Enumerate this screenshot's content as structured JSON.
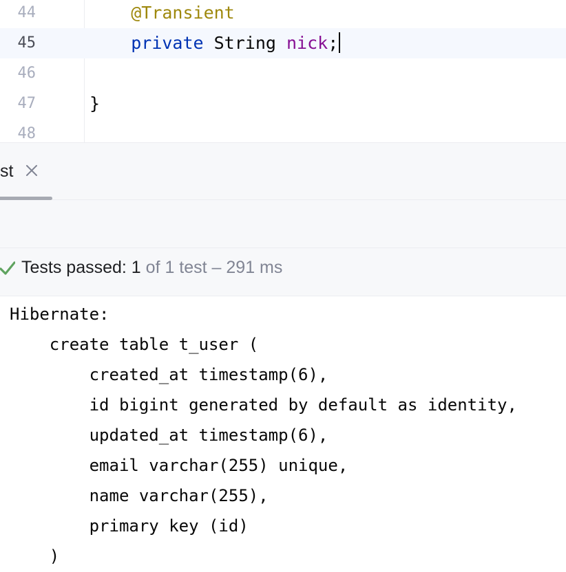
{
  "editor": {
    "lines": [
      {
        "number": "44",
        "segments": [
          {
            "text": "    ",
            "cls": ""
          },
          {
            "text": "@Transient",
            "cls": "ann"
          }
        ]
      },
      {
        "number": "45",
        "current": true,
        "segments": [
          {
            "text": "    ",
            "cls": ""
          },
          {
            "text": "private",
            "cls": "kw"
          },
          {
            "text": " String ",
            "cls": ""
          },
          {
            "text": "nick",
            "cls": "field"
          },
          {
            "text": ";",
            "cls": ""
          }
        ]
      },
      {
        "number": "46",
        "segments": []
      },
      {
        "number": "47",
        "segments": [
          {
            "text": "}",
            "cls": ""
          }
        ]
      },
      {
        "number": "48",
        "segments": []
      }
    ]
  },
  "run_panel": {
    "tab_label": "st",
    "close_icon": "close-icon"
  },
  "status": {
    "icon": "check-icon",
    "color": "#5fa35f",
    "passed_label": "Tests passed: 1",
    "detail": " of 1 test – 291 ms"
  },
  "console": {
    "lines": [
      "Hibernate: ",
      "    create table t_user (",
      "        created_at timestamp(6),",
      "        id bigint generated by default as identity,",
      "        updated_at timestamp(6),",
      "        email varchar(255) unique,",
      "        name varchar(255),",
      "        primary key (id)",
      "    )"
    ]
  }
}
